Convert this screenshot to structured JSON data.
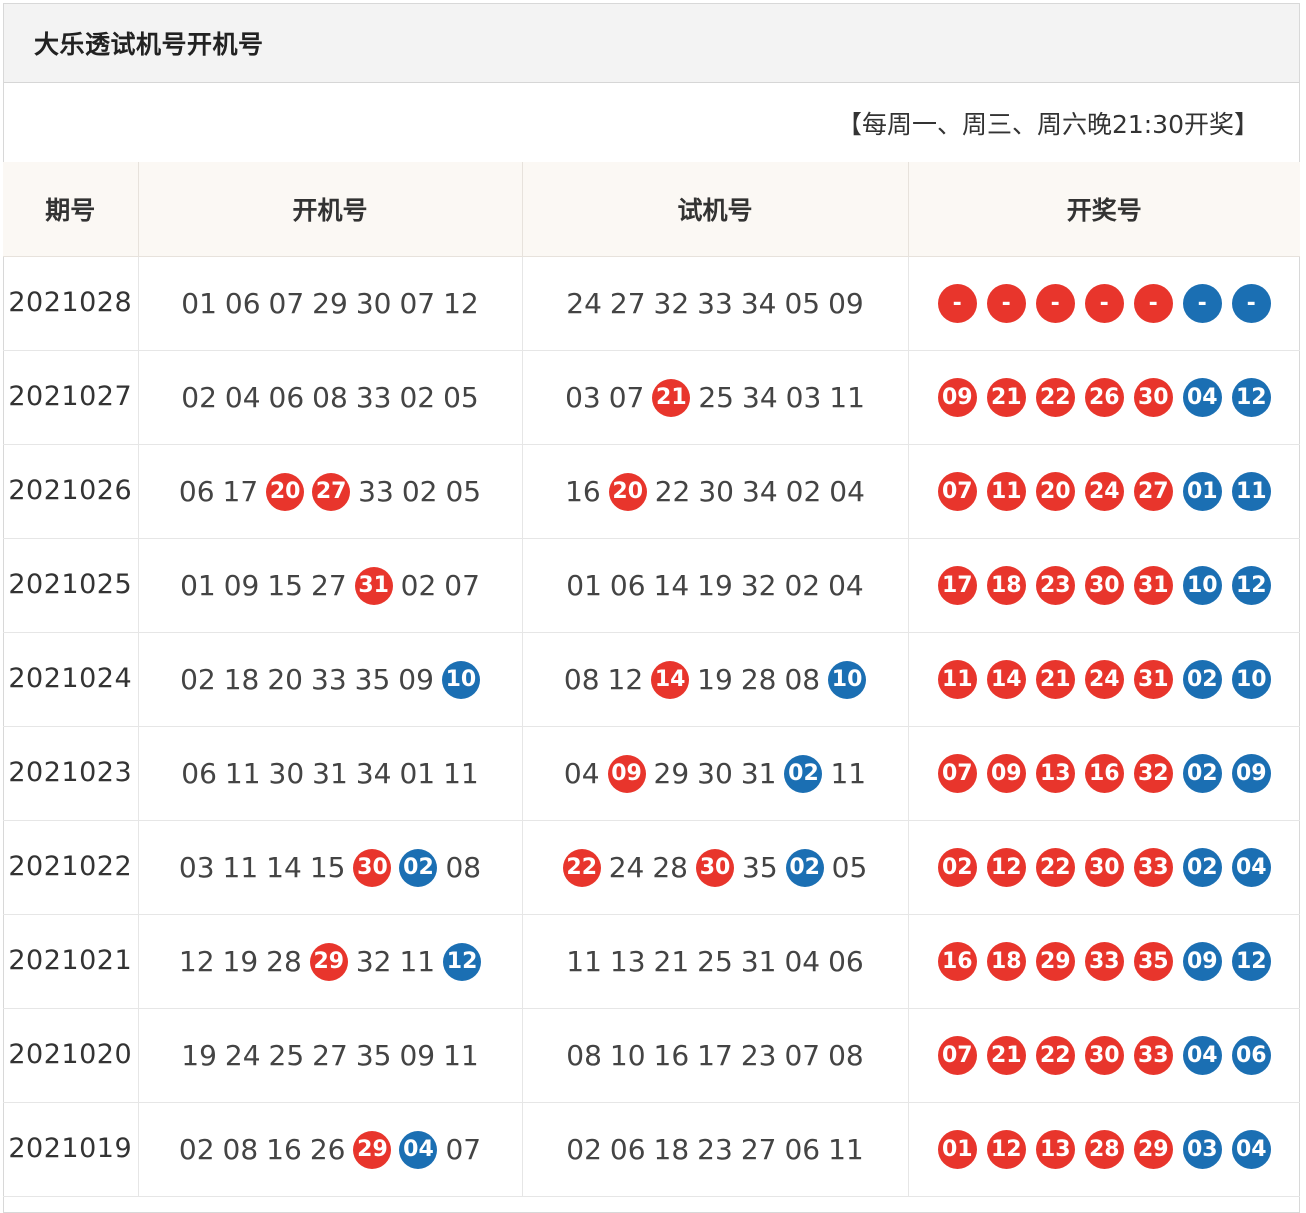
{
  "title": "大乐透试机号开机号",
  "notice": "【每周一、周三、周六晚21:30开奖】",
  "headers": [
    "期号",
    "开机号",
    "试机号",
    "开奖号"
  ],
  "colors": {
    "red": "#e8352c",
    "blue": "#1b6fb3"
  },
  "rows": [
    {
      "issue": "2021028",
      "open": [
        [
          "01",
          "n"
        ],
        [
          "06",
          "n"
        ],
        [
          "07",
          "n"
        ],
        [
          "29",
          "n"
        ],
        [
          "30",
          "n"
        ],
        [
          "07",
          "n"
        ],
        [
          "12",
          "n"
        ]
      ],
      "trial": [
        [
          "24",
          "n"
        ],
        [
          "27",
          "n"
        ],
        [
          "32",
          "n"
        ],
        [
          "33",
          "n"
        ],
        [
          "34",
          "n"
        ],
        [
          "05",
          "n"
        ],
        [
          "09",
          "n"
        ]
      ],
      "draw": [
        [
          "-",
          "r"
        ],
        [
          "-",
          "r"
        ],
        [
          "-",
          "r"
        ],
        [
          "-",
          "r"
        ],
        [
          "-",
          "r"
        ],
        [
          "-",
          "b"
        ],
        [
          "-",
          "b"
        ]
      ]
    },
    {
      "issue": "2021027",
      "open": [
        [
          "02",
          "n"
        ],
        [
          "04",
          "n"
        ],
        [
          "06",
          "n"
        ],
        [
          "08",
          "n"
        ],
        [
          "33",
          "n"
        ],
        [
          "02",
          "n"
        ],
        [
          "05",
          "n"
        ]
      ],
      "trial": [
        [
          "03",
          "n"
        ],
        [
          "07",
          "n"
        ],
        [
          "21",
          "r"
        ],
        [
          "25",
          "n"
        ],
        [
          "34",
          "n"
        ],
        [
          "03",
          "n"
        ],
        [
          "11",
          "n"
        ]
      ],
      "draw": [
        [
          "09",
          "r"
        ],
        [
          "21",
          "r"
        ],
        [
          "22",
          "r"
        ],
        [
          "26",
          "r"
        ],
        [
          "30",
          "r"
        ],
        [
          "04",
          "b"
        ],
        [
          "12",
          "b"
        ]
      ]
    },
    {
      "issue": "2021026",
      "open": [
        [
          "06",
          "n"
        ],
        [
          "17",
          "n"
        ],
        [
          "20",
          "r"
        ],
        [
          "27",
          "r"
        ],
        [
          "33",
          "n"
        ],
        [
          "02",
          "n"
        ],
        [
          "05",
          "n"
        ]
      ],
      "trial": [
        [
          "16",
          "n"
        ],
        [
          "20",
          "r"
        ],
        [
          "22",
          "n"
        ],
        [
          "30",
          "n"
        ],
        [
          "34",
          "n"
        ],
        [
          "02",
          "n"
        ],
        [
          "04",
          "n"
        ]
      ],
      "draw": [
        [
          "07",
          "r"
        ],
        [
          "11",
          "r"
        ],
        [
          "20",
          "r"
        ],
        [
          "24",
          "r"
        ],
        [
          "27",
          "r"
        ],
        [
          "01",
          "b"
        ],
        [
          "11",
          "b"
        ]
      ]
    },
    {
      "issue": "2021025",
      "open": [
        [
          "01",
          "n"
        ],
        [
          "09",
          "n"
        ],
        [
          "15",
          "n"
        ],
        [
          "27",
          "n"
        ],
        [
          "31",
          "r"
        ],
        [
          "02",
          "n"
        ],
        [
          "07",
          "n"
        ]
      ],
      "trial": [
        [
          "01",
          "n"
        ],
        [
          "06",
          "n"
        ],
        [
          "14",
          "n"
        ],
        [
          "19",
          "n"
        ],
        [
          "32",
          "n"
        ],
        [
          "02",
          "n"
        ],
        [
          "04",
          "n"
        ]
      ],
      "draw": [
        [
          "17",
          "r"
        ],
        [
          "18",
          "r"
        ],
        [
          "23",
          "r"
        ],
        [
          "30",
          "r"
        ],
        [
          "31",
          "r"
        ],
        [
          "10",
          "b"
        ],
        [
          "12",
          "b"
        ]
      ]
    },
    {
      "issue": "2021024",
      "open": [
        [
          "02",
          "n"
        ],
        [
          "18",
          "n"
        ],
        [
          "20",
          "n"
        ],
        [
          "33",
          "n"
        ],
        [
          "35",
          "n"
        ],
        [
          "09",
          "n"
        ],
        [
          "10",
          "b"
        ]
      ],
      "trial": [
        [
          "08",
          "n"
        ],
        [
          "12",
          "n"
        ],
        [
          "14",
          "r"
        ],
        [
          "19",
          "n"
        ],
        [
          "28",
          "n"
        ],
        [
          "08",
          "n"
        ],
        [
          "10",
          "b"
        ]
      ],
      "draw": [
        [
          "11",
          "r"
        ],
        [
          "14",
          "r"
        ],
        [
          "21",
          "r"
        ],
        [
          "24",
          "r"
        ],
        [
          "31",
          "r"
        ],
        [
          "02",
          "b"
        ],
        [
          "10",
          "b"
        ]
      ]
    },
    {
      "issue": "2021023",
      "open": [
        [
          "06",
          "n"
        ],
        [
          "11",
          "n"
        ],
        [
          "30",
          "n"
        ],
        [
          "31",
          "n"
        ],
        [
          "34",
          "n"
        ],
        [
          "01",
          "n"
        ],
        [
          "11",
          "n"
        ]
      ],
      "trial": [
        [
          "04",
          "n"
        ],
        [
          "09",
          "r"
        ],
        [
          "29",
          "n"
        ],
        [
          "30",
          "n"
        ],
        [
          "31",
          "n"
        ],
        [
          "02",
          "b"
        ],
        [
          "11",
          "n"
        ]
      ],
      "draw": [
        [
          "07",
          "r"
        ],
        [
          "09",
          "r"
        ],
        [
          "13",
          "r"
        ],
        [
          "16",
          "r"
        ],
        [
          "32",
          "r"
        ],
        [
          "02",
          "b"
        ],
        [
          "09",
          "b"
        ]
      ]
    },
    {
      "issue": "2021022",
      "open": [
        [
          "03",
          "n"
        ],
        [
          "11",
          "n"
        ],
        [
          "14",
          "n"
        ],
        [
          "15",
          "n"
        ],
        [
          "30",
          "r"
        ],
        [
          "02",
          "b"
        ],
        [
          "08",
          "n"
        ]
      ],
      "trial": [
        [
          "22",
          "r"
        ],
        [
          "24",
          "n"
        ],
        [
          "28",
          "n"
        ],
        [
          "30",
          "r"
        ],
        [
          "35",
          "n"
        ],
        [
          "02",
          "b"
        ],
        [
          "05",
          "n"
        ]
      ],
      "draw": [
        [
          "02",
          "r"
        ],
        [
          "12",
          "r"
        ],
        [
          "22",
          "r"
        ],
        [
          "30",
          "r"
        ],
        [
          "33",
          "r"
        ],
        [
          "02",
          "b"
        ],
        [
          "04",
          "b"
        ]
      ]
    },
    {
      "issue": "2021021",
      "open": [
        [
          "12",
          "n"
        ],
        [
          "19",
          "n"
        ],
        [
          "28",
          "n"
        ],
        [
          "29",
          "r"
        ],
        [
          "32",
          "n"
        ],
        [
          "11",
          "n"
        ],
        [
          "12",
          "b"
        ]
      ],
      "trial": [
        [
          "11",
          "n"
        ],
        [
          "13",
          "n"
        ],
        [
          "21",
          "n"
        ],
        [
          "25",
          "n"
        ],
        [
          "31",
          "n"
        ],
        [
          "04",
          "n"
        ],
        [
          "06",
          "n"
        ]
      ],
      "draw": [
        [
          "16",
          "r"
        ],
        [
          "18",
          "r"
        ],
        [
          "29",
          "r"
        ],
        [
          "33",
          "r"
        ],
        [
          "35",
          "r"
        ],
        [
          "09",
          "b"
        ],
        [
          "12",
          "b"
        ]
      ]
    },
    {
      "issue": "2021020",
      "open": [
        [
          "19",
          "n"
        ],
        [
          "24",
          "n"
        ],
        [
          "25",
          "n"
        ],
        [
          "27",
          "n"
        ],
        [
          "35",
          "n"
        ],
        [
          "09",
          "n"
        ],
        [
          "11",
          "n"
        ]
      ],
      "trial": [
        [
          "08",
          "n"
        ],
        [
          "10",
          "n"
        ],
        [
          "16",
          "n"
        ],
        [
          "17",
          "n"
        ],
        [
          "23",
          "n"
        ],
        [
          "07",
          "n"
        ],
        [
          "08",
          "n"
        ]
      ],
      "draw": [
        [
          "07",
          "r"
        ],
        [
          "21",
          "r"
        ],
        [
          "22",
          "r"
        ],
        [
          "30",
          "r"
        ],
        [
          "33",
          "r"
        ],
        [
          "04",
          "b"
        ],
        [
          "06",
          "b"
        ]
      ]
    },
    {
      "issue": "2021019",
      "open": [
        [
          "02",
          "n"
        ],
        [
          "08",
          "n"
        ],
        [
          "16",
          "n"
        ],
        [
          "26",
          "n"
        ],
        [
          "29",
          "r"
        ],
        [
          "04",
          "b"
        ],
        [
          "07",
          "n"
        ]
      ],
      "trial": [
        [
          "02",
          "n"
        ],
        [
          "06",
          "n"
        ],
        [
          "18",
          "n"
        ],
        [
          "23",
          "n"
        ],
        [
          "27",
          "n"
        ],
        [
          "06",
          "n"
        ],
        [
          "11",
          "n"
        ]
      ],
      "draw": [
        [
          "01",
          "r"
        ],
        [
          "12",
          "r"
        ],
        [
          "13",
          "r"
        ],
        [
          "28",
          "r"
        ],
        [
          "29",
          "r"
        ],
        [
          "03",
          "b"
        ],
        [
          "04",
          "b"
        ]
      ]
    }
  ]
}
